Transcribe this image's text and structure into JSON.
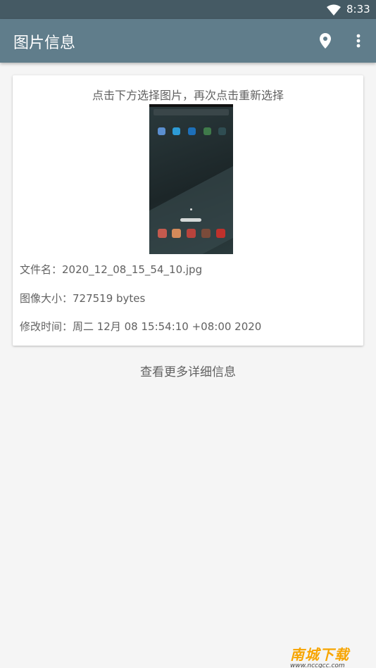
{
  "status_bar": {
    "time": "8:33"
  },
  "app_bar": {
    "title": "图片信息"
  },
  "card": {
    "hint": "点击下方选择图片，再次点击重新选择",
    "file_name": "文件名：2020_12_08_15_54_10.jpg",
    "image_size": "图像大小：727519 bytes",
    "modified_time": "修改时间：周二 12月 08 15:54:10 +08:00 2020"
  },
  "more_details": "查看更多详细信息",
  "watermark": {
    "brand": "南城下载",
    "url": "www.nccgcc.com"
  },
  "colors": {
    "status_bar": "#455a64",
    "app_bar": "#607d8b",
    "background": "#f5f5f5",
    "text": "#616161"
  }
}
